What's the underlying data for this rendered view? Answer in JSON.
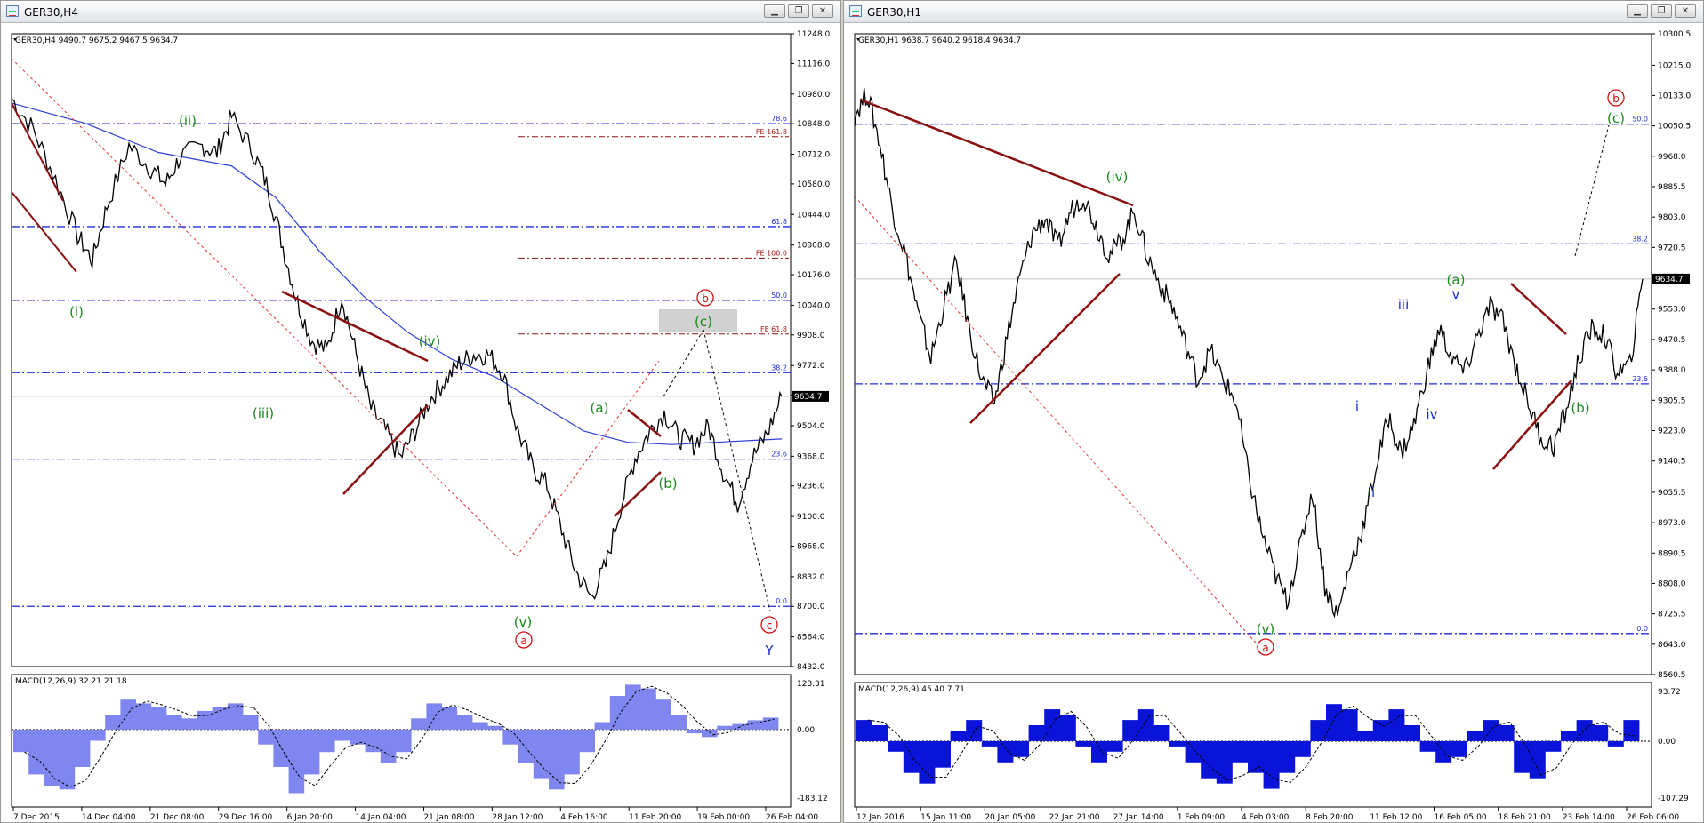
{
  "chart_data": [
    {
      "type": "line",
      "window_title": "GER30,H4",
      "header": "GER30,H4  9490.7 9675.2 9467.5 9634.7",
      "price_ticks": [
        "11248.0",
        "11116.0",
        "10980.0",
        "10848.0",
        "10712.0",
        "10580.0",
        "10444.0",
        "10308.0",
        "10176.0",
        "10040.0",
        "9908.0",
        "9772.0",
        "9640.0",
        "9504.0",
        "9368.0",
        "9236.0",
        "9100.0",
        "8968.0",
        "8832.0",
        "8700.0",
        "8564.0",
        "8432.0"
      ],
      "ylim": [
        8432,
        11248
      ],
      "current_price": "9634.7",
      "time_labels": [
        "7 Dec 2015",
        "14 Dec 04:00",
        "21 Dec 08:00",
        "29 Dec 16:00",
        "6 Jan 20:00",
        "14 Jan 04:00",
        "21 Jan 08:00",
        "28 Jan 12:00",
        "4 Feb 16:00",
        "11 Feb 20:00",
        "19 Feb 00:00",
        "26 Feb 04:00"
      ],
      "fib_levels": [
        {
          "label": "78.6",
          "value": 10848
        },
        {
          "label": "61.8",
          "value": 10390
        },
        {
          "label": "50.0",
          "value": 10062
        },
        {
          "label": "38.2",
          "value": 9740
        },
        {
          "label": "23.6",
          "value": 9355
        },
        {
          "label": "0.0",
          "value": 8700
        }
      ],
      "fe_levels": [
        {
          "label": "FE 161.8",
          "value": 10790
        },
        {
          "label": "FE 100.0",
          "value": 10250
        },
        {
          "label": "FE 61.8",
          "value": 9912
        }
      ],
      "wave_labels": [
        "(i)",
        "(ii)",
        "(iii)",
        "(iv)",
        "(v)",
        "(a)",
        "(b)",
        "(c)",
        "a",
        "b",
        "c",
        "Y"
      ],
      "price_path": [
        [
          0,
          10960
        ],
        [
          3,
          10820
        ],
        [
          6,
          10600
        ],
        [
          9,
          10350
        ],
        [
          11,
          10240
        ],
        [
          13,
          10480
        ],
        [
          16,
          10750
        ],
        [
          19,
          10650
        ],
        [
          21,
          10580
        ],
        [
          23,
          10700
        ],
        [
          26,
          10750
        ],
        [
          28,
          10720
        ],
        [
          30,
          10880
        ],
        [
          33,
          10720
        ],
        [
          35,
          10560
        ],
        [
          37,
          10300
        ],
        [
          39,
          10050
        ],
        [
          41,
          9880
        ],
        [
          43,
          9840
        ],
        [
          45,
          10080
        ],
        [
          47,
          9820
        ],
        [
          49,
          9580
        ],
        [
          51,
          9480
        ],
        [
          53,
          9360
        ],
        [
          55,
          9480
        ],
        [
          57,
          9620
        ],
        [
          59,
          9700
        ],
        [
          61,
          9780
        ],
        [
          63,
          9820
        ],
        [
          65,
          9820
        ],
        [
          67,
          9740
        ],
        [
          69,
          9480
        ],
        [
          71,
          9320
        ],
        [
          73,
          9240
        ],
        [
          75,
          9040
        ],
        [
          77,
          8850
        ],
        [
          79,
          8740
        ],
        [
          81,
          8880
        ],
        [
          83,
          9140
        ],
        [
          85,
          9360
        ],
        [
          87,
          9480
        ],
        [
          89,
          9560
        ],
        [
          91,
          9450
        ],
        [
          93,
          9420
        ],
        [
          95,
          9500
        ],
        [
          97,
          9300
        ],
        [
          99,
          9160
        ],
        [
          101,
          9360
        ],
        [
          103,
          9470
        ],
        [
          105,
          9634.7
        ]
      ],
      "ma_path": [
        [
          0,
          10940
        ],
        [
          10,
          10850
        ],
        [
          20,
          10720
        ],
        [
          30,
          10660
        ],
        [
          36,
          10520
        ],
        [
          42,
          10280
        ],
        [
          48,
          10080
        ],
        [
          54,
          9920
        ],
        [
          60,
          9800
        ],
        [
          66,
          9720
        ],
        [
          72,
          9600
        ],
        [
          78,
          9480
        ],
        [
          84,
          9430
        ],
        [
          90,
          9420
        ],
        [
          96,
          9430
        ],
        [
          102,
          9440
        ],
        [
          105,
          9445
        ]
      ],
      "macd": {
        "label": "MACD(12,26,9) 32.21 21.18",
        "ticks": [
          "123.31",
          "0.00",
          "-183.12"
        ],
        "range": [
          -183.12,
          123.31
        ],
        "values": [
          -60,
          -120,
          -150,
          -160,
          -100,
          -30,
          40,
          80,
          70,
          60,
          40,
          30,
          50,
          60,
          70,
          40,
          -40,
          -100,
          -170,
          -120,
          -60,
          -30,
          -40,
          -60,
          -90,
          -60,
          30,
          70,
          60,
          40,
          20,
          10,
          -40,
          -90,
          -130,
          -160,
          -120,
          -60,
          20,
          90,
          120,
          110,
          80,
          40,
          -10,
          -20,
          10,
          15,
          25,
          32
        ]
      }
    },
    {
      "type": "line",
      "window_title": "GER30,H1",
      "header": "GER30,H1  9638.7 9640.2 9618.4 9634.7",
      "price_ticks": [
        "10300.5",
        "10215.0",
        "10133.0",
        "10050.5",
        "9968.0",
        "9885.5",
        "9803.0",
        "9720.5",
        "9634.7",
        "9553.0",
        "9470.5",
        "9388.0",
        "9305.5",
        "9223.0",
        "9140.5",
        "9055.5",
        "8973.0",
        "8890.5",
        "8808.0",
        "8725.5",
        "8643.0",
        "8560.5"
      ],
      "ylim": [
        8560.5,
        10300.5
      ],
      "current_price": "9634.7",
      "time_labels": [
        "12 Jan 2016",
        "15 Jan 11:00",
        "20 Jan 05:00",
        "22 Jan 21:00",
        "27 Jan 14:00",
        "1 Feb 09:00",
        "4 Feb 03:00",
        "8 Feb 20:00",
        "11 Feb 12:00",
        "16 Feb 05:00",
        "18 Feb 21:00",
        "23 Feb 14:00",
        "26 Feb 06:00"
      ],
      "fib_levels": [
        {
          "label": "50.0",
          "value": 10055
        },
        {
          "label": "38.2",
          "value": 9730
        },
        {
          "label": "23.6",
          "value": 9350
        },
        {
          "label": "0.0",
          "value": 8672
        }
      ],
      "wave_labels": [
        "(iv)",
        "(a)",
        "(b)",
        "(c)",
        "(v)",
        "i",
        "ii",
        "iii",
        "iv",
        "v",
        "a",
        "b"
      ],
      "price_path": [
        [
          0,
          10080
        ],
        [
          2,
          10140
        ],
        [
          4,
          10000
        ],
        [
          6,
          9820
        ],
        [
          8,
          9700
        ],
        [
          10,
          9540
        ],
        [
          12,
          9420
        ],
        [
          14,
          9560
        ],
        [
          16,
          9680
        ],
        [
          18,
          9500
        ],
        [
          20,
          9360
        ],
        [
          22,
          9300
        ],
        [
          24,
          9480
        ],
        [
          26,
          9640
        ],
        [
          28,
          9760
        ],
        [
          30,
          9800
        ],
        [
          32,
          9720
        ],
        [
          34,
          9820
        ],
        [
          36,
          9860
        ],
        [
          38,
          9780
        ],
        [
          40,
          9700
        ],
        [
          42,
          9740
        ],
        [
          44,
          9820
        ],
        [
          46,
          9700
        ],
        [
          48,
          9620
        ],
        [
          50,
          9560
        ],
        [
          52,
          9460
        ],
        [
          54,
          9360
        ],
        [
          56,
          9440
        ],
        [
          58,
          9360
        ],
        [
          60,
          9300
        ],
        [
          62,
          9100
        ],
        [
          64,
          8950
        ],
        [
          66,
          8840
        ],
        [
          68,
          8760
        ],
        [
          70,
          8900
        ],
        [
          72,
          9060
        ],
        [
          74,
          8800
        ],
        [
          76,
          8720
        ],
        [
          78,
          8860
        ],
        [
          80,
          8960
        ],
        [
          82,
          9120
        ],
        [
          84,
          9260
        ],
        [
          86,
          9160
        ],
        [
          88,
          9240
        ],
        [
          90,
          9380
        ],
        [
          92,
          9500
        ],
        [
          94,
          9420
        ],
        [
          96,
          9380
        ],
        [
          98,
          9480
        ],
        [
          100,
          9560
        ],
        [
          102,
          9520
        ],
        [
          104,
          9400
        ],
        [
          106,
          9300
        ],
        [
          108,
          9200
        ],
        [
          110,
          9180
        ],
        [
          112,
          9280
        ],
        [
          114,
          9420
        ],
        [
          116,
          9500
        ],
        [
          118,
          9480
        ],
        [
          120,
          9380
        ],
        [
          122,
          9400
        ],
        [
          124,
          9634.7
        ]
      ],
      "macd": {
        "label": "MACD(12,26,9) 45.40 7.71",
        "ticks": [
          "93.72",
          "0.00",
          "-107.29"
        ],
        "range": [
          -107.29,
          93.72
        ],
        "values": [
          40,
          30,
          -20,
          -60,
          -80,
          -50,
          20,
          40,
          -10,
          -40,
          -30,
          30,
          60,
          50,
          -10,
          -40,
          -20,
          40,
          60,
          30,
          -10,
          -40,
          -70,
          -80,
          -40,
          -60,
          -90,
          -60,
          -30,
          40,
          70,
          60,
          20,
          40,
          60,
          30,
          -20,
          -40,
          -30,
          20,
          40,
          30,
          -60,
          -70,
          -20,
          20,
          40,
          30,
          -10,
          40
        ]
      }
    }
  ]
}
